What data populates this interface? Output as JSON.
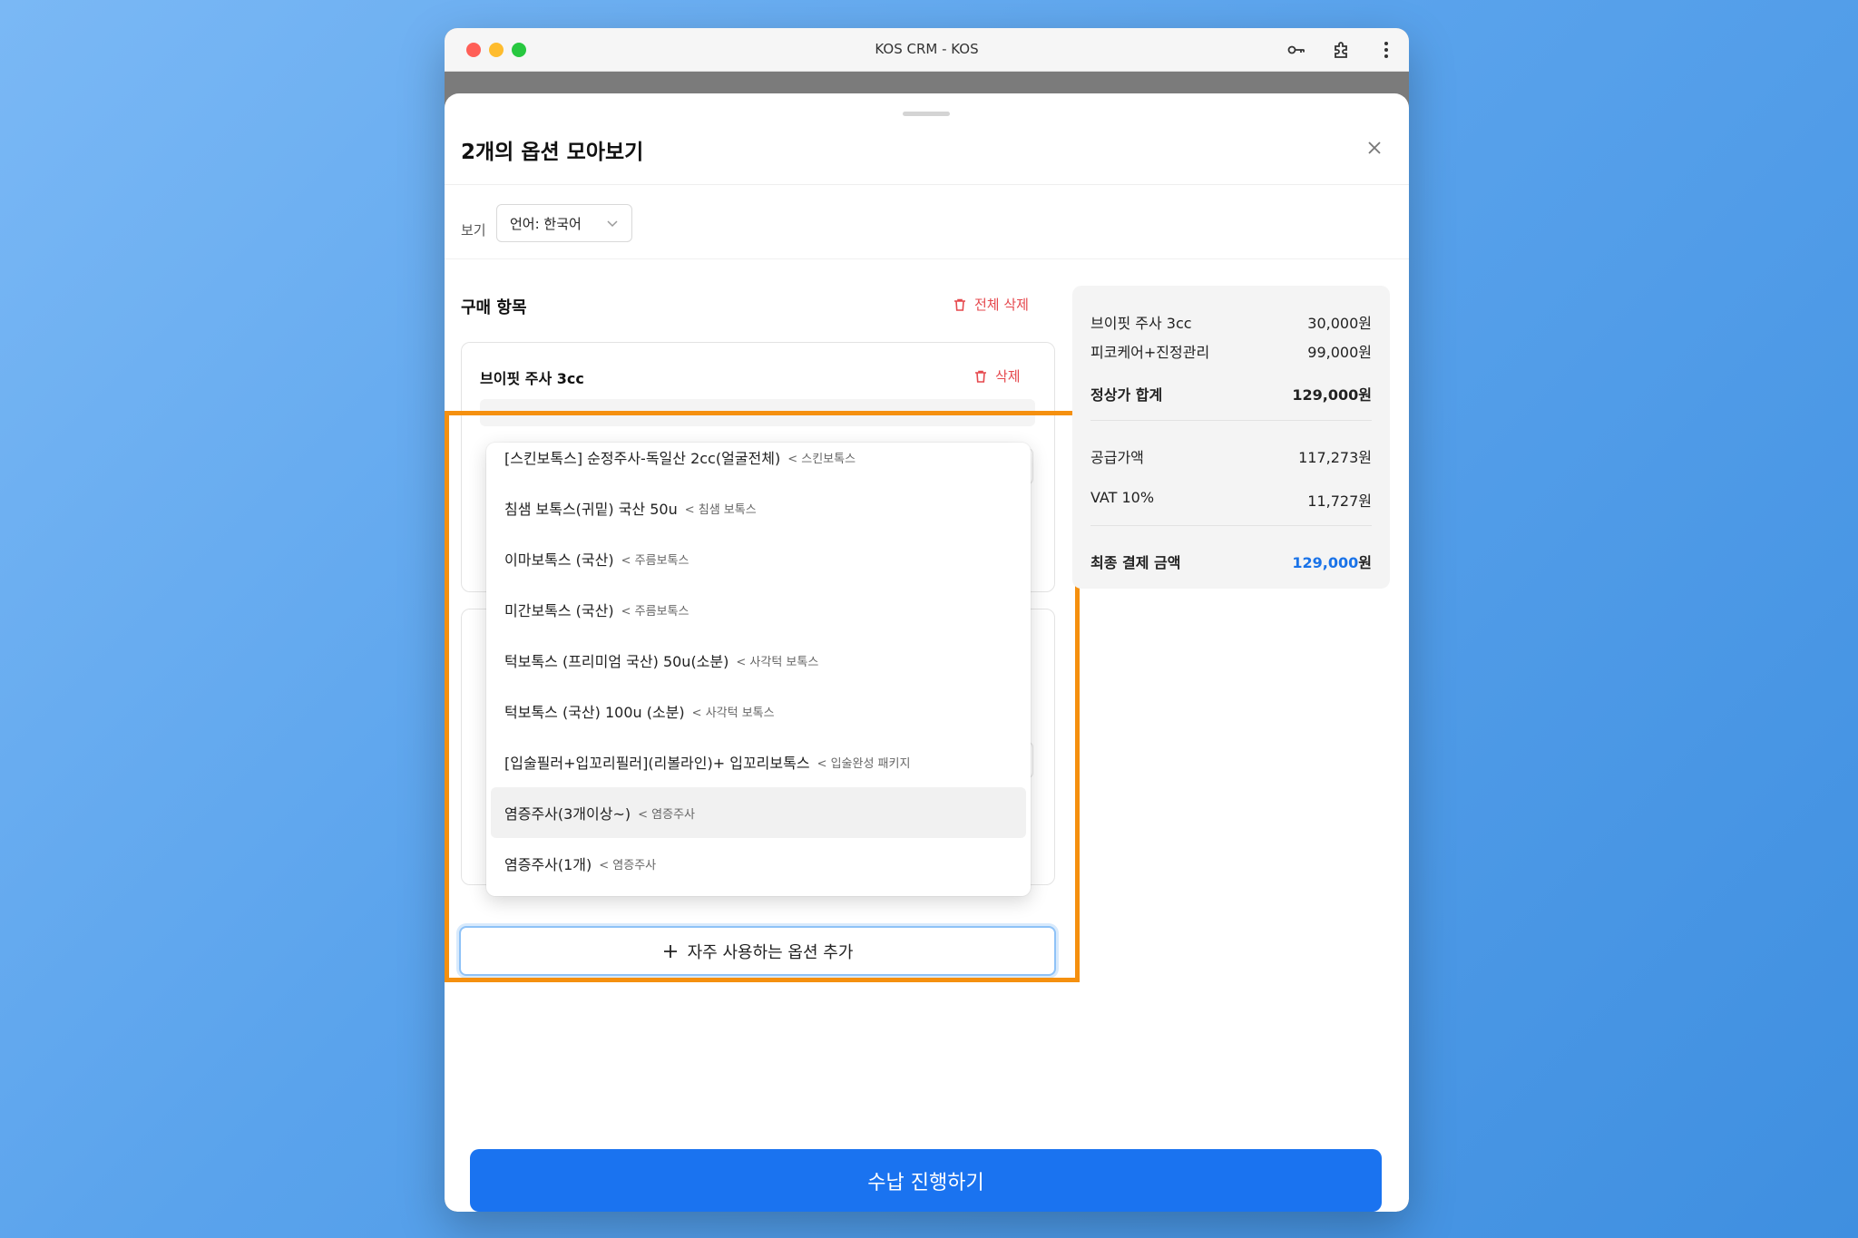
{
  "window": {
    "title": "KOS CRM - KOS"
  },
  "sheet": {
    "title": "2개의 옵션 모아보기",
    "view_label": "보기",
    "language_select": "언어: 한국어"
  },
  "purchase": {
    "section_title": "구매 항목",
    "delete_all": "전체 삭제",
    "item1": {
      "name": "브이핏 주사 3cc",
      "delete": "삭제"
    }
  },
  "dropdown": {
    "items": [
      {
        "name": "[스킨보톡스] 순정주사-독일산 2cc(얼굴전체)",
        "category": "< 스킨보톡스"
      },
      {
        "name": "침샘 보톡스(귀밑) 국산 50u",
        "category": "< 침샘 보톡스"
      },
      {
        "name": "이마보톡스 (국산)",
        "category": "< 주름보톡스"
      },
      {
        "name": "미간보톡스 (국산)",
        "category": "< 주름보톡스"
      },
      {
        "name": "턱보톡스 (프리미엄 국산) 50u(소분)",
        "category": "< 사각턱 보톡스"
      },
      {
        "name": "턱보톡스 (국산) 100u (소분)",
        "category": "< 사각턱 보톡스"
      },
      {
        "name": "[입술필러+입꼬리필러](리볼라인)+ 입꼬리보톡스",
        "category": "< 입술완성 패키지"
      },
      {
        "name": "염증주사(3개이상~)",
        "category": "< 염증주사"
      },
      {
        "name": "염증주사(1개)",
        "category": "< 염증주사"
      }
    ]
  },
  "add_button": "자주 사용하는 옵션 추가",
  "summary": {
    "lines": [
      {
        "label": "브이핏 주사 3cc",
        "value": "30,000원"
      },
      {
        "label": "피코케어+진정관리",
        "value": "99,000원"
      }
    ],
    "list_total_label": "정상가 합계",
    "list_total_value": "129,000원",
    "supply_label": "공급가액",
    "supply_value": "117,273원",
    "vat_label": "VAT 10%",
    "vat_value": "11,727원",
    "final_label": "최종 결제 금액",
    "final_amount": "129,000",
    "final_unit": "원"
  },
  "pay_button": "수납 진행하기",
  "colors": {
    "accent": "#1a73f0",
    "danger": "#e5484d",
    "highlight": "#f5900f"
  }
}
